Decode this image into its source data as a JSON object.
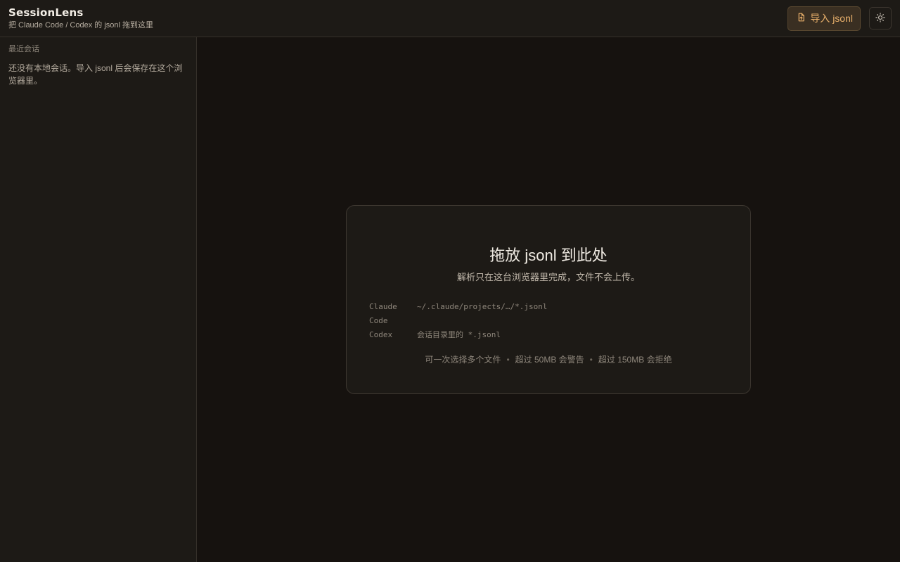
{
  "header": {
    "title": "SessionLens",
    "subtitle": "把 Claude Code / Codex 的 jsonl 拖到这里",
    "import_label": "导入 jsonl",
    "import_icon": "file-import-icon",
    "theme_icon": "sun-icon"
  },
  "sidebar": {
    "section_label": "最近会话",
    "empty_text": "还没有本地会话。导入 jsonl 后会保存在这个浏览器里。"
  },
  "dropzone": {
    "title": "拖放 jsonl 到此处",
    "subtitle": "解析只在这台浏览器里完成，文件不会上传。",
    "paths": [
      {
        "tool": "Claude Code",
        "path": "~/.claude/projects/…/*.jsonl"
      },
      {
        "tool": "Codex",
        "path": "会话目录里的 *.jsonl"
      }
    ],
    "notes": [
      "可一次选择多个文件",
      "超过 50MB 会警告",
      "超过 150MB 会拒绝"
    ],
    "separator": "•"
  },
  "colors": {
    "accent": "#e9b06b",
    "background": "#16120f",
    "panel": "#1d1a16"
  }
}
